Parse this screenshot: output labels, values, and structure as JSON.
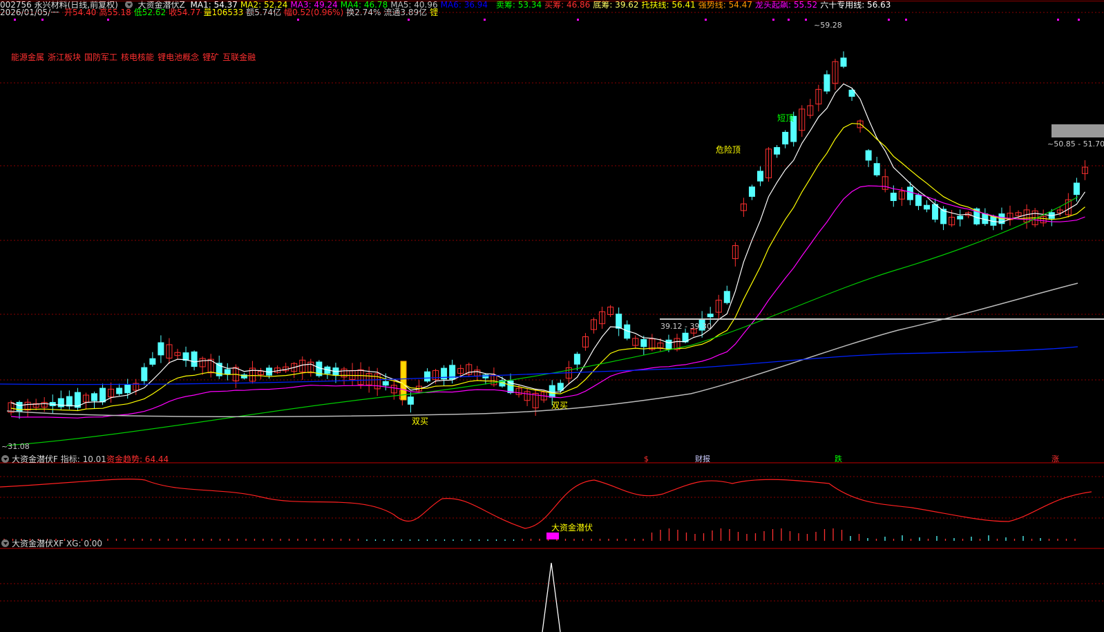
{
  "header": {
    "stock": "002756 永兴材料(日线,前复权)",
    "indicator_name": "大资金潜伏Z",
    "ma": [
      {
        "label": "MA1: 54.37",
        "color": "#ffffff"
      },
      {
        "label": "MA2: 52.24",
        "color": "#ffff00"
      },
      {
        "label": "MA3: 49.24",
        "color": "#ff00ff"
      },
      {
        "label": "MA4: 46.78",
        "color": "#00ff00"
      },
      {
        "label": "MA5: 40.96",
        "color": "#c0c0c0"
      },
      {
        "label": "MA6: 36.94",
        "color": "#0000ff"
      }
    ],
    "lines": [
      {
        "label": "卖筹: 53.34",
        "color": "#00ff00"
      },
      {
        "label": "买筹: 46.86",
        "color": "#ff3030"
      },
      {
        "label": "底筹: 39.62",
        "color": "#ffff66"
      },
      {
        "label": "托扶线: 56.41",
        "color": "#ffff00"
      },
      {
        "label": "强势线: 54.47",
        "color": "#ff9900"
      },
      {
        "label": "龙头起飙: 55.52",
        "color": "#ff00ff"
      },
      {
        "label": "六十专用线: 56.63",
        "color": "#ffffff"
      }
    ]
  },
  "quote": {
    "date": "2026/01/05/一",
    "items": [
      {
        "label": "开54.40",
        "color": "#ff3030"
      },
      {
        "label": "高55.18",
        "color": "#ff3030"
      },
      {
        "label": "低52.62",
        "color": "#00ff00"
      },
      {
        "label": "收54.77",
        "color": "#ff3030"
      },
      {
        "label": "量106533",
        "color": "#ffff00"
      },
      {
        "label": "额5.74亿",
        "color": "#cccccc"
      },
      {
        "label": "幅0.52(0.96%)",
        "color": "#ff3030"
      },
      {
        "label": "换2.74%",
        "color": "#cccccc"
      },
      {
        "label": "流通3.89亿",
        "color": "#cccccc"
      },
      {
        "label": "锂",
        "color": "#ffff00"
      }
    ]
  },
  "concepts": [
    "能源金属",
    "浙江板块",
    "国防军工",
    "核电核能",
    "锂电池概念",
    "锂矿",
    "互联金融"
  ],
  "annotations": {
    "high_label": "59.28",
    "low_label": "31.08",
    "range1": "39.12 - 39.30",
    "range2": "50.85 - 51.70",
    "danger_top": "危险顶",
    "short_top": "短顶",
    "double_buy_1": "双买",
    "double_buy_2": "双买",
    "event_s": "$",
    "event_report": "财报",
    "event_fall": "跌",
    "event_rise": "涨"
  },
  "panel2": {
    "name": "大资金潜伏F",
    "items": [
      {
        "label": "指标: 10.01",
        "color": "#cccccc"
      },
      {
        "label": "资金趋势: 64.44",
        "color": "#ff3030"
      }
    ],
    "marker": "大资金潜伏"
  },
  "panel3": {
    "name": "大资金潜伏XF",
    "items": [
      {
        "label": "XG: 0.00",
        "color": "#cccccc"
      }
    ]
  },
  "colors": {
    "up": "#ff3030",
    "down": "#54ffff",
    "bg": "#000000",
    "grid": "#8b0000"
  }
}
